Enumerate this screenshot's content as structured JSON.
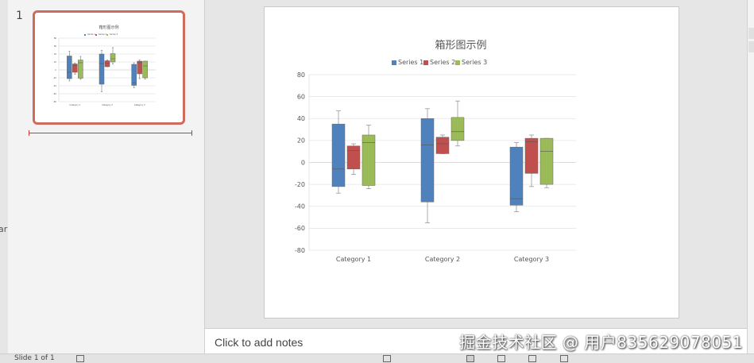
{
  "left_edge": {
    "text": "ar"
  },
  "thumbnails": {
    "slide_number": "1"
  },
  "notes": {
    "placeholder": "Click to add notes"
  },
  "status": {
    "slide_info": "Slide 1 of 1"
  },
  "watermark": "掘金技术社区 @ 用户835629078051",
  "colors": {
    "series1": "#4f81bd",
    "series2": "#c0504d",
    "series3": "#9bbb59",
    "selection": "#d06a5c"
  },
  "chart_data": {
    "type": "boxplot",
    "title": "箱形图示例",
    "categories": [
      "Category 1",
      "Category 2",
      "Category 3"
    ],
    "ylim": [
      -80,
      80
    ],
    "yticks": [
      80,
      60,
      40,
      20,
      0,
      -20,
      -40,
      -60,
      -80
    ],
    "grid": true,
    "legend_position": "top",
    "series": [
      {
        "name": "Series 1",
        "color": "#4f81bd",
        "boxes": [
          {
            "min": -28,
            "q1": -22,
            "median": -6,
            "q3": 35,
            "max": 47
          },
          {
            "min": -55,
            "q1": -36,
            "median": 16,
            "q3": 40,
            "max": 49
          },
          {
            "min": -45,
            "q1": -39,
            "median": -33,
            "q3": 14,
            "max": 18
          }
        ]
      },
      {
        "name": "Series 2",
        "color": "#c0504d",
        "boxes": [
          {
            "min": -11,
            "q1": -6,
            "median": 11,
            "q3": 15,
            "max": 17
          },
          {
            "min": 8,
            "q1": 8,
            "median": 17,
            "q3": 23,
            "max": 25
          },
          {
            "min": -22,
            "q1": -10,
            "median": 19,
            "q3": 22,
            "max": 25
          }
        ]
      },
      {
        "name": "Series 3",
        "color": "#9bbb59",
        "boxes": [
          {
            "min": -24,
            "q1": -21,
            "median": 18,
            "q3": 25,
            "max": 34
          },
          {
            "min": 15,
            "q1": 20,
            "median": 28,
            "q3": 41,
            "max": 56
          },
          {
            "min": -23,
            "q1": -20,
            "median": 10,
            "q3": 22,
            "max": 22
          }
        ]
      }
    ]
  }
}
